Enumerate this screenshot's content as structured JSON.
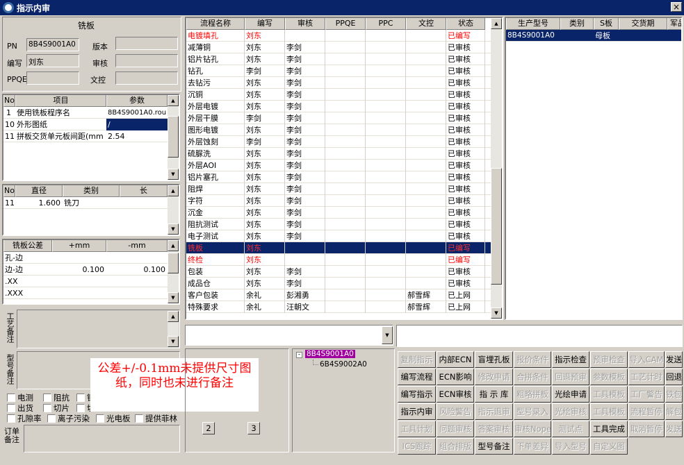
{
  "window": {
    "title": "指示内审",
    "close": "×"
  },
  "board": {
    "title": "铣板",
    "pn_label": "PN",
    "pn_value": "8B4S9001A0",
    "version_label": "版本",
    "writer_label": "编写",
    "writer_value": "刘东",
    "reviewer_label": "审核",
    "ppqe_label": "PPQE",
    "doc_label": "文控"
  },
  "param_grid": {
    "headers": [
      "No",
      "项目",
      "参数"
    ],
    "rows": [
      {
        "no": "1",
        "item": "使用铣板程序名",
        "value": "8B4S9001A0.rou"
      },
      {
        "no": "10",
        "item": "外形图纸",
        "value": "/"
      },
      {
        "no": "11",
        "item": "拼板交货单元板间距(mm",
        "value": "2.54"
      }
    ]
  },
  "tool_grid": {
    "headers": [
      "No",
      "直径",
      "类别",
      "长"
    ],
    "rows": [
      {
        "no": "11",
        "diameter": "1.600",
        "type": "铣刀",
        "length": ""
      }
    ]
  },
  "tol_grid": {
    "headers": [
      "铣板公差",
      "+mm",
      "-mm"
    ],
    "rows": [
      {
        "name": "孔-边",
        "plus": "",
        "minus": ""
      },
      {
        "name": "边-边",
        "plus": "0.100",
        "minus": "0.100"
      },
      {
        "name": ".XX",
        "plus": "",
        "minus": ""
      },
      {
        "name": ".XXX",
        "plus": "",
        "minus": ""
      }
    ]
  },
  "remarks": {
    "process_label": "工艺备注",
    "model_label": "型号备注",
    "order_label": "订单备注"
  },
  "checkboxes": [
    {
      "label": "电测"
    },
    {
      "label": "阻抗"
    },
    {
      "label": "钢"
    },
    {
      "label": "出货"
    },
    {
      "label": "切片"
    },
    {
      "label": "切"
    },
    {
      "label": "孔隙率"
    },
    {
      "label": "离子污染"
    },
    {
      "label": "光电板"
    },
    {
      "label": "提供菲林"
    }
  ],
  "annotation": {
    "text": "公差+/-0.1mm未提供尺寸图纸，同时也未进行备注"
  },
  "flow_grid": {
    "headers": [
      "流程名称",
      "编写",
      "审核",
      "PPQE",
      "PPC",
      "文控",
      "状态"
    ],
    "rows": [
      {
        "name": "电镀填孔",
        "writer": "刘东",
        "reviewer": "",
        "ppqe": "",
        "ppc": "",
        "doc": "",
        "status": "已编写",
        "red": true
      },
      {
        "name": "减薄铜",
        "writer": "刘东",
        "reviewer": "李剑",
        "ppqe": "",
        "ppc": "",
        "doc": "",
        "status": "已审核"
      },
      {
        "name": "铝片钻孔",
        "writer": "刘东",
        "reviewer": "李剑",
        "ppqe": "",
        "ppc": "",
        "doc": "",
        "status": "已审核"
      },
      {
        "name": "钻孔",
        "writer": "李剑",
        "reviewer": "李剑",
        "ppqe": "",
        "ppc": "",
        "doc": "",
        "status": "已审核"
      },
      {
        "name": "去钻污",
        "writer": "刘东",
        "reviewer": "李剑",
        "ppqe": "",
        "ppc": "",
        "doc": "",
        "status": "已审核"
      },
      {
        "name": "沉铜",
        "writer": "刘东",
        "reviewer": "李剑",
        "ppqe": "",
        "ppc": "",
        "doc": "",
        "status": "已审核"
      },
      {
        "name": "外层电镀",
        "writer": "刘东",
        "reviewer": "李剑",
        "ppqe": "",
        "ppc": "",
        "doc": "",
        "status": "已审核"
      },
      {
        "name": "外层干膜",
        "writer": "李剑",
        "reviewer": "李剑",
        "ppqe": "",
        "ppc": "",
        "doc": "",
        "status": "已审核"
      },
      {
        "name": "图形电镀",
        "writer": "刘东",
        "reviewer": "李剑",
        "ppqe": "",
        "ppc": "",
        "doc": "",
        "status": "已审核"
      },
      {
        "name": "外层蚀刻",
        "writer": "李剑",
        "reviewer": "李剑",
        "ppqe": "",
        "ppc": "",
        "doc": "",
        "status": "已审核"
      },
      {
        "name": "硫脲洗",
        "writer": "刘东",
        "reviewer": "李剑",
        "ppqe": "",
        "ppc": "",
        "doc": "",
        "status": "已审核"
      },
      {
        "name": "外层AOI",
        "writer": "刘东",
        "reviewer": "李剑",
        "ppqe": "",
        "ppc": "",
        "doc": "",
        "status": "已审核"
      },
      {
        "name": "铝片塞孔",
        "writer": "刘东",
        "reviewer": "李剑",
        "ppqe": "",
        "ppc": "",
        "doc": "",
        "status": "已审核"
      },
      {
        "name": "阻焊",
        "writer": "刘东",
        "reviewer": "李剑",
        "ppqe": "",
        "ppc": "",
        "doc": "",
        "status": "已审核"
      },
      {
        "name": "字符",
        "writer": "刘东",
        "reviewer": "李剑",
        "ppqe": "",
        "ppc": "",
        "doc": "",
        "status": "已审核"
      },
      {
        "name": "沉金",
        "writer": "刘东",
        "reviewer": "李剑",
        "ppqe": "",
        "ppc": "",
        "doc": "",
        "status": "已审核"
      },
      {
        "name": "阻抗测试",
        "writer": "刘东",
        "reviewer": "李剑",
        "ppqe": "",
        "ppc": "",
        "doc": "",
        "status": "已审核"
      },
      {
        "name": "电子测试",
        "writer": "刘东",
        "reviewer": "李剑",
        "ppqe": "",
        "ppc": "",
        "doc": "",
        "status": "已审核"
      },
      {
        "name": "铣板",
        "writer": "刘东",
        "reviewer": "",
        "ppqe": "",
        "ppc": "",
        "doc": "",
        "status": "已编写",
        "red": true,
        "selected": true
      },
      {
        "name": "终检",
        "writer": "刘东",
        "reviewer": "",
        "ppqe": "",
        "ppc": "",
        "doc": "",
        "status": "已编写",
        "red": true
      },
      {
        "name": "包装",
        "writer": "刘东",
        "reviewer": "李剑",
        "ppqe": "",
        "ppc": "",
        "doc": "",
        "status": "已审核"
      },
      {
        "name": "成品仓",
        "writer": "刘东",
        "reviewer": "李剑",
        "ppqe": "",
        "ppc": "",
        "doc": "",
        "status": "已审核"
      },
      {
        "name": "客户包装",
        "writer": "余礼",
        "reviewer": "彭湘勇",
        "ppqe": "",
        "ppc": "",
        "doc": "郝雪辉",
        "status": "已上网"
      },
      {
        "name": "特殊要求",
        "writer": "余礼",
        "reviewer": "汪朝文",
        "ppqe": "",
        "ppc": "",
        "doc": "郝雪辉",
        "status": "已上网"
      }
    ]
  },
  "prod_grid": {
    "headers": [
      "生产型号",
      "类别",
      "S板",
      "交货期",
      "军品"
    ],
    "rows": [
      {
        "model": "8B4S9001A0",
        "type": "",
        "s": "母板",
        "date": "",
        "mil": ""
      }
    ]
  },
  "tree": {
    "root": "8B4S9001A0",
    "child": "6B4S9002A0"
  },
  "pager": {
    "p2": "2",
    "p3": "3"
  },
  "buttons": [
    [
      "复制指示",
      "内部ECN",
      "盲埋孔板",
      "报价条件",
      "指示检查",
      "预审检查",
      "导入CAM",
      "发送"
    ],
    [
      "编写流程",
      "ECN影响",
      "修改申请",
      "合拼条件",
      "回退预审",
      "参数模板",
      "工艺计时",
      "回退"
    ],
    [
      "编写指示",
      "ECN审核",
      "指 示 库",
      "粗略拼板",
      "光绘申请",
      "工具模板",
      "工厂警告",
      "铁包"
    ],
    [
      "指示内审",
      "风险警告",
      "指示退审",
      "型号录入",
      "光绘审核",
      "工具模板",
      "流程暂停",
      "解包"
    ],
    [
      "工具计划",
      "问题审核",
      "答案审核",
      "审核Nope",
      "测试点",
      "工具完成",
      "取消暂停",
      "发送"
    ],
    [
      "ICS跟踪",
      "组合排版",
      "型号备注",
      "下单差异",
      "导入型号",
      "自定义图",
      "",
      ""
    ]
  ],
  "buttons_disabled": [
    [
      true,
      false,
      false,
      true,
      false,
      true,
      true,
      false
    ],
    [
      false,
      false,
      true,
      true,
      true,
      true,
      true,
      false
    ],
    [
      false,
      false,
      false,
      true,
      false,
      true,
      true,
      true
    ],
    [
      false,
      true,
      true,
      true,
      true,
      true,
      true,
      true
    ],
    [
      true,
      true,
      true,
      true,
      true,
      false,
      true,
      true
    ],
    [
      true,
      true,
      false,
      true,
      true,
      true,
      true,
      true
    ]
  ]
}
